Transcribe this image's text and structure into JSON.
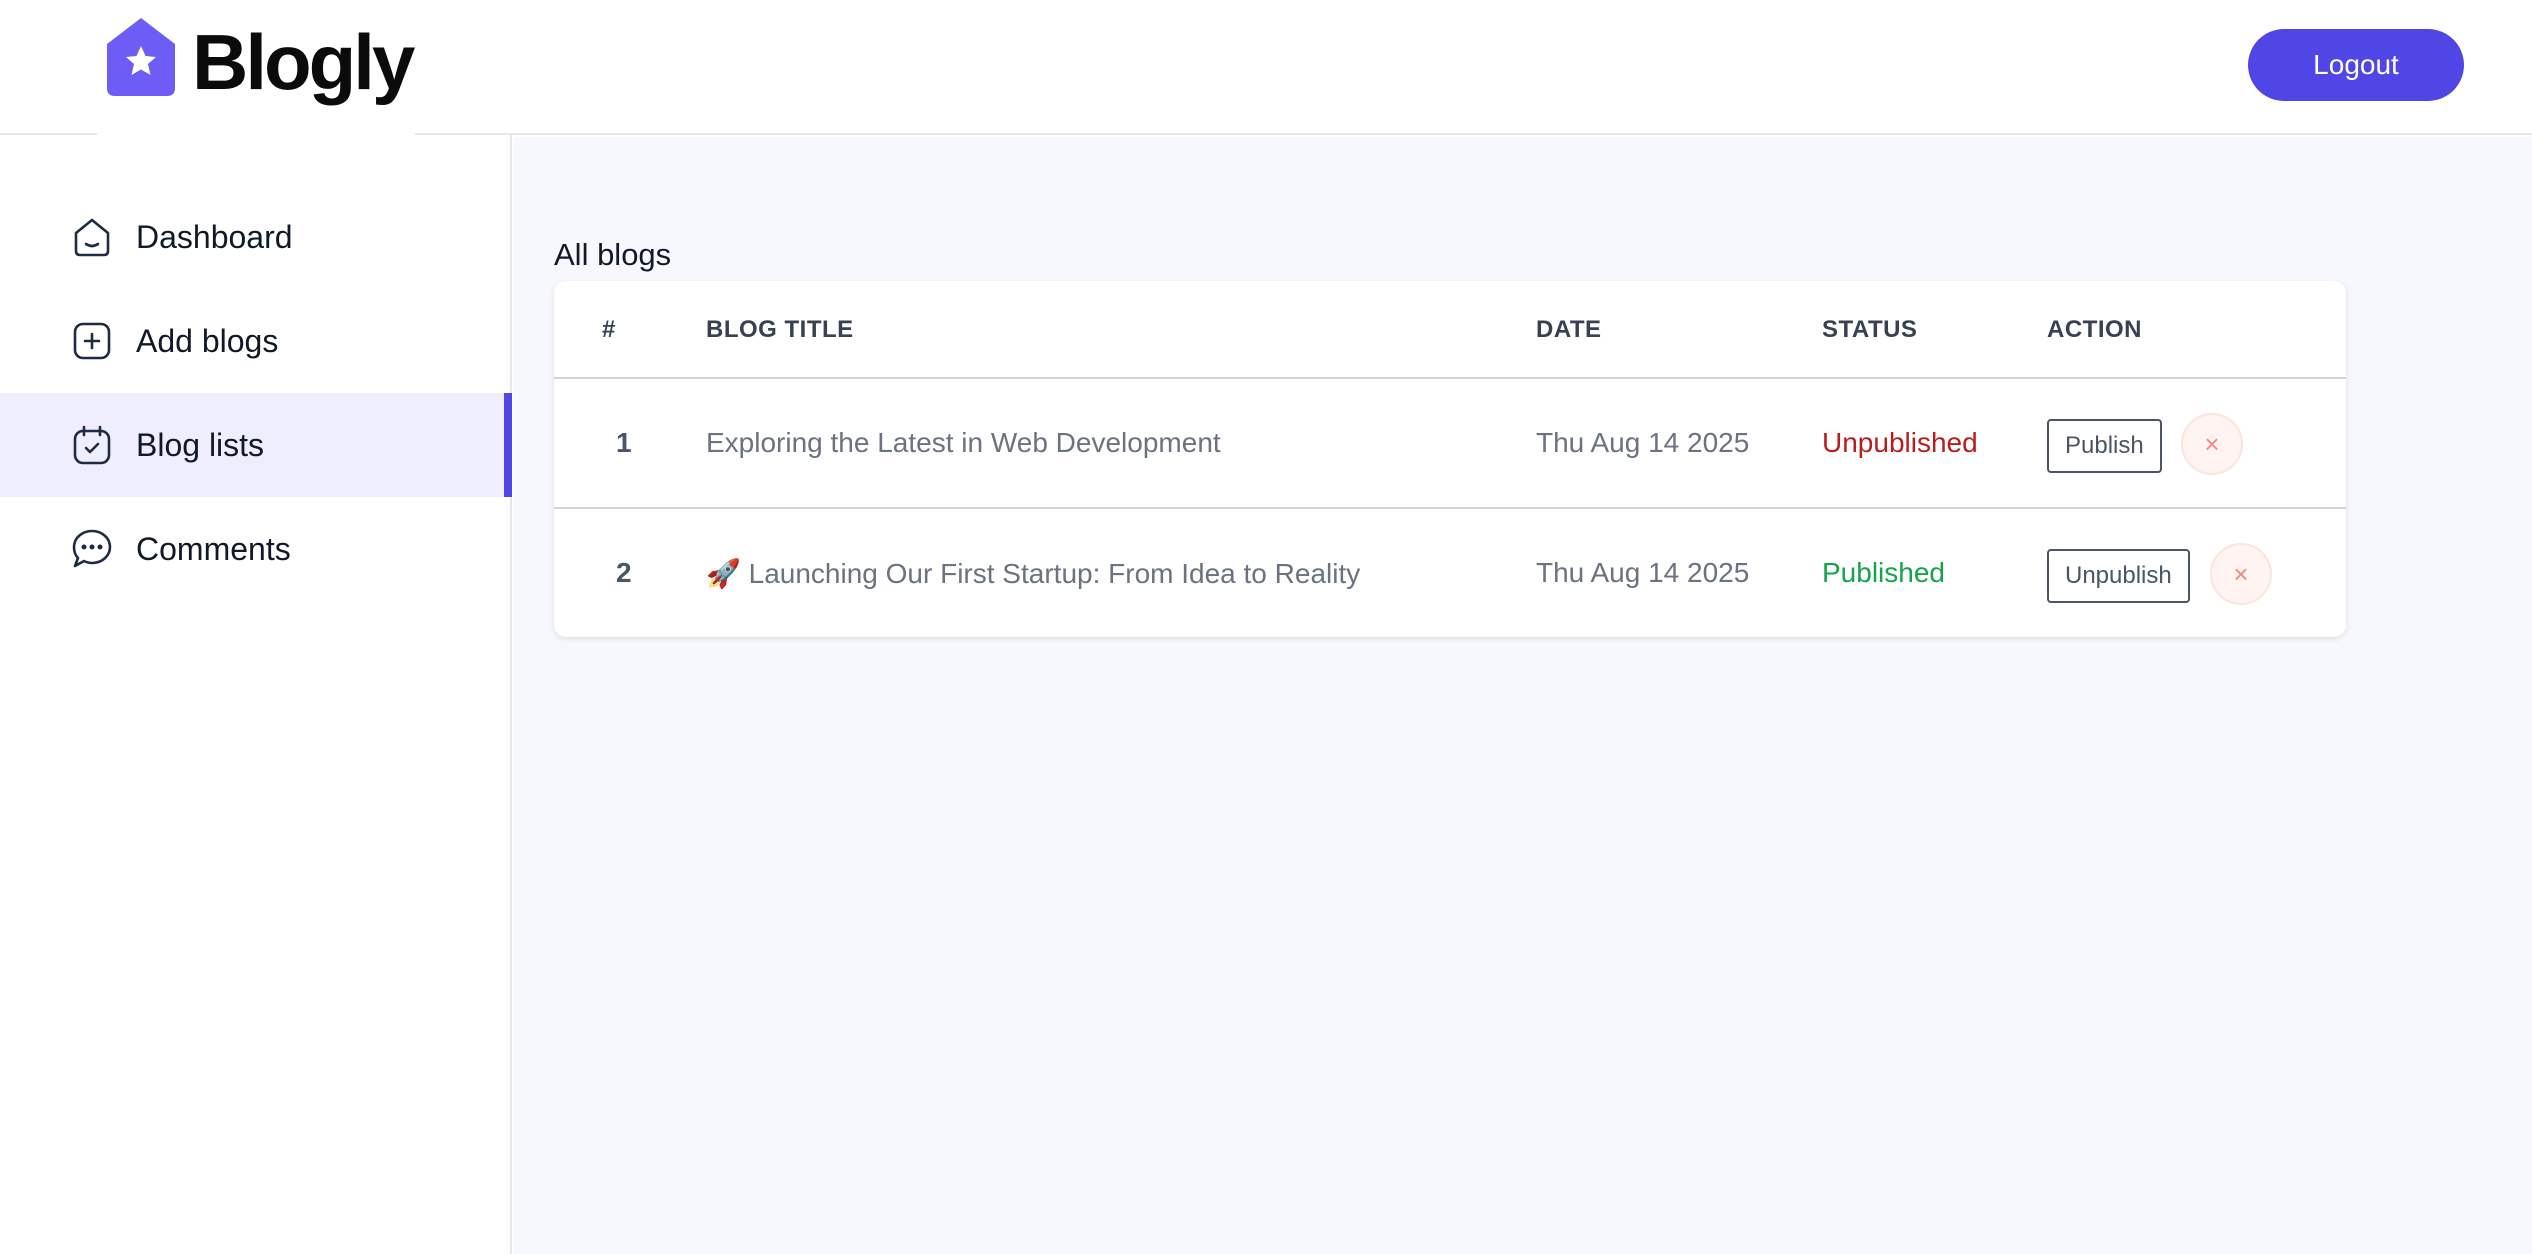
{
  "app": {
    "brand": "Blogly",
    "brand_color": "#5046e5",
    "logout_label": "Logout"
  },
  "sidebar": {
    "items": [
      {
        "label": "Dashboard",
        "icon": "home-icon",
        "active": false
      },
      {
        "label": "Add blogs",
        "icon": "add-square-icon",
        "active": false
      },
      {
        "label": "Blog lists",
        "icon": "calendar-check-icon",
        "active": true
      },
      {
        "label": "Comments",
        "icon": "chat-bubble-icon",
        "active": false
      }
    ]
  },
  "main": {
    "title": "All blogs",
    "table": {
      "headers": [
        "#",
        "BLOG TITLE",
        "DATE",
        "STATUS",
        "ACTION"
      ],
      "rows": [
        {
          "index": "1",
          "title": "Exploring the Latest in Web Development",
          "date": "Thu Aug 14 2025",
          "status": "Unpublished",
          "status_color": "#b91c1c",
          "action_label": "Publish",
          "delete_glyph": "×"
        },
        {
          "index": "2",
          "title": "🚀 Launching Our First Startup: From Idea to Reality",
          "date": "Thu Aug 14 2025",
          "status": "Published",
          "status_color": "#16a34a",
          "action_label": "Unpublish",
          "delete_glyph": "×"
        }
      ]
    }
  }
}
